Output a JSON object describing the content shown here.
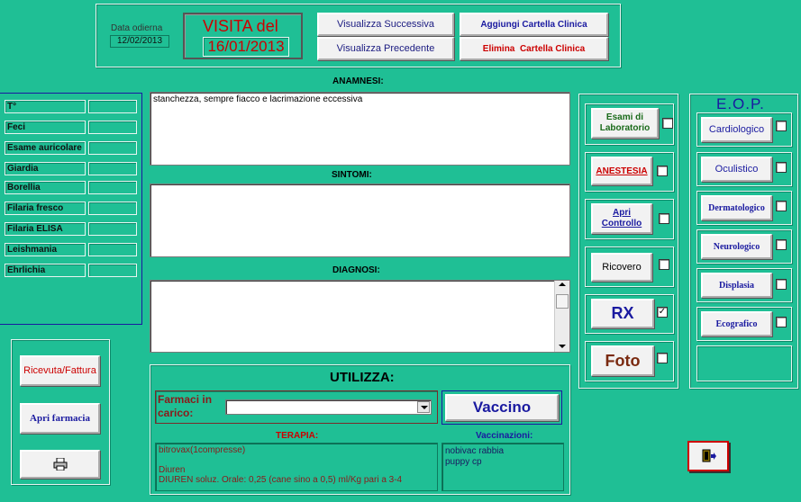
{
  "header": {
    "date_label": "Data odierna",
    "date_value": "12/02/2013",
    "visit_title": "VISITA del",
    "visit_date": "16/01/2013",
    "next_button": "Visualizza Successiva",
    "prev_button": "Visualizza Precedente",
    "add_button": "Aggiungi Cartella Clinica",
    "delete_button_a": "Elimina",
    "delete_button_b": "Cartella Clinica"
  },
  "sections": {
    "anamnesi_label": "ANAMNESI:",
    "anamnesi_text": "stanchezza, sempre fiacco e lacrimazione eccessiva",
    "sintomi_label": "SINTOMI:",
    "sintomi_text": "",
    "diagnosi_label": "DIAGNOSI:",
    "diagnosi_text": ""
  },
  "sidebar": {
    "items": [
      {
        "label": "T°"
      },
      {
        "label": "Feci"
      },
      {
        "label": "Esame auricolare"
      },
      {
        "label": "Giardia"
      },
      {
        "label": "Borellia"
      },
      {
        "label": "Filaria fresco"
      },
      {
        "label": "Filaria ELISA"
      },
      {
        "label": "Leishmania"
      },
      {
        "label": "Ehrlichia"
      }
    ]
  },
  "left_buttons": {
    "receipt": "Ricevuta/Fattura",
    "pharmacy": "Apri farmacia",
    "print_icon": "printer-icon"
  },
  "utilizza": {
    "title": "UTILIZZA:",
    "farmaci_label": "Farmaci in carico:",
    "farmaci_value": "",
    "vaccino_button": "Vaccino",
    "terapia_label": "TERAPIA:",
    "terapia_lines": [
      "bitrovax(1compresse)",
      "",
      "Diuren",
      "DIUREN soluz. Orale:  0,25 (cane sino a 0,5) ml/Kg pari a 3-4"
    ],
    "vaccinazioni_label": "Vaccinazioni:",
    "vaccinazioni_lines": [
      "nobivac rabbia",
      "puppy cp"
    ]
  },
  "actions": [
    {
      "label": "Esami di Laboratorio",
      "checked": false
    },
    {
      "label": "ANESTESIA",
      "checked": false
    },
    {
      "label": "Apri Controllo",
      "checked": false
    },
    {
      "label": "Ricovero",
      "checked": false
    },
    {
      "label": "RX",
      "checked": true
    },
    {
      "label": "Foto",
      "checked": false
    }
  ],
  "eop": {
    "title": "E.O.P.",
    "items": [
      {
        "label": "Cardiologico",
        "checked": false
      },
      {
        "label": "Oculistico",
        "checked": false
      },
      {
        "label": "Dermatologico",
        "checked": false
      },
      {
        "label": "Neurologico",
        "checked": false
      },
      {
        "label": "Displasia",
        "checked": false
      },
      {
        "label": "Ecografico",
        "checked": false
      }
    ]
  },
  "exit_icon": "exit-door-icon",
  "colors": {
    "background": "#1fbf95",
    "red": "#cc0000",
    "blue": "#1a1aa0"
  }
}
